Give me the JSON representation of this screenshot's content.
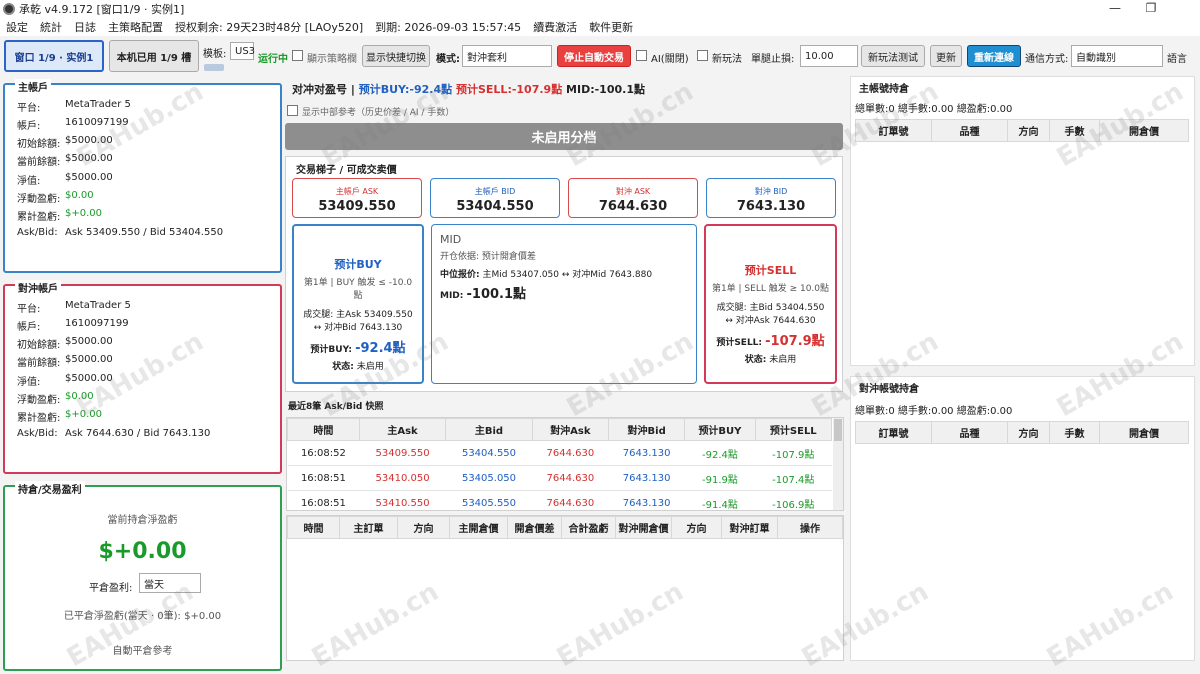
{
  "window": {
    "title": "承乾 v4.9.172 [窗口1/9 · 实例1]",
    "minimize": "—",
    "restore": "❐"
  },
  "menu": [
    "設定",
    "統計",
    "日誌",
    "主策略配置",
    "授权剩余: 29天23时48分 [LAOy520]",
    "到期: 2026-09-03 15:57:45",
    "續費激活",
    "軟件更新"
  ],
  "toolbar": {
    "window_btn": "窗口 1/9 · 实例1",
    "used_btn": "本机已用 1/9 槽",
    "template_label": "模板:",
    "template_value": "US3",
    "running": "运行中",
    "show_strategy": "顯示策略欄",
    "show_quick": "显示快捷切换",
    "mode_label": "模式:",
    "mode_value": "對沖套利",
    "stop_btn": "停止自動交易",
    "ai_label": "AI(關閉)",
    "new_play": "新玩法",
    "single_stop_label": "單腿止損:",
    "single_stop_value": "10.00",
    "new_test": "新玩法测试",
    "refresh": "更新",
    "reconnect": "重新連線",
    "comm_label": "通信方式:",
    "comm_value": "自動識別",
    "lang": "語言"
  },
  "main_account": {
    "title": "主帳戶",
    "rows": [
      {
        "k": "平台:",
        "v": "MetaTrader 5"
      },
      {
        "k": "帳戶:",
        "v": "1610097199"
      },
      {
        "k": "初始餘額:",
        "v": "$5000.00"
      },
      {
        "k": "當前餘額:",
        "v": "$5000.00"
      },
      {
        "k": "淨值:",
        "v": "$5000.00"
      },
      {
        "k": "浮動盈虧:",
        "v": "$0.00"
      },
      {
        "k": "累計盈虧:",
        "v": "$+0.00"
      },
      {
        "k": "Ask/Bid:",
        "v": "Ask 53409.550 / Bid 53404.550"
      }
    ]
  },
  "hedge_account": {
    "title": "對沖帳戶",
    "rows": [
      {
        "k": "平台:",
        "v": "MetaTrader 5"
      },
      {
        "k": "帳戶:",
        "v": "1610097199"
      },
      {
        "k": "初始餘額:",
        "v": "$5000.00"
      },
      {
        "k": "當前餘額:",
        "v": "$5000.00"
      },
      {
        "k": "淨值:",
        "v": "$5000.00"
      },
      {
        "k": "浮動盈虧:",
        "v": "$0.00"
      },
      {
        "k": "累計盈虧:",
        "v": "$+0.00"
      },
      {
        "k": "Ask/Bid:",
        "v": "Ask 7644.630 / Bid 7643.130"
      }
    ]
  },
  "position_pnl": {
    "title": "持倉/交易盈利",
    "current_label": "當前持倉淨盈虧",
    "current_value": "$+0.00",
    "close_label": "平倉盈利:",
    "close_value": "當天",
    "closed_text": "已平倉淨盈虧(當天 · 0筆): $+0.00",
    "auto_close": "自動平倉參考"
  },
  "center": {
    "pair_label": "对冲对盈号 |",
    "est_buy": "预计BUY:-92.4點",
    "est_sell": "预计SELL:-107.9點",
    "mid": "MID:-100.1點",
    "show_mid_ref": "显示中部参考（历史价差 / AI / 手数）",
    "grid_bar": "未启用分档",
    "ladder_title": "交易梯子 / 可成交卖價",
    "quotes": [
      {
        "label": "主帳戶 ASK",
        "value": "53409.550"
      },
      {
        "label": "主帳戶 BID",
        "value": "53404.550"
      },
      {
        "label": "對沖 ASK",
        "value": "7644.630"
      },
      {
        "label": "對沖 BID",
        "value": "7643.130"
      }
    ],
    "buy_box": {
      "title": "预计BUY",
      "line1": "第1单 | BUY 触发 ≤ -10.0",
      "line1b": "點",
      "line2": "成交腿: 主Ask 53409.550",
      "line3": "↔ 对冲Bid 7643.130",
      "est_label": "预计BUY:",
      "est_value": "-92.4點",
      "status_label": "状态:",
      "status_value": "未启用"
    },
    "mid_box": {
      "title": "MID",
      "basis": "开仓依据: 预计開倉價差",
      "ref_label": "中位报价:",
      "ref_value": "主Mid 53407.050 ↔ 对冲Mid 7643.880",
      "mid_label": "MID:",
      "mid_value": "-100.1點"
    },
    "sell_box": {
      "title": "预计SELL",
      "line1": "第1单 | SELL 触发 ≥ 10.0點",
      "line2": "成交腿: 主Bid 53404.550",
      "line3": "↔ 对冲Ask 7644.630",
      "est_label": "预计SELL:",
      "est_value": "-107.9點",
      "status_label": "状态:",
      "status_value": "未启用"
    },
    "recent_title": "最近8筆 Ask/Bid 快照",
    "recent_headers": [
      "時間",
      "主Ask",
      "主Bid",
      "對沖Ask",
      "對沖Bid",
      "预计BUY",
      "预计SELL"
    ],
    "recent_rows": [
      [
        "16:08:52",
        "53409.550",
        "53404.550",
        "7644.630",
        "7643.130",
        "-92.4點",
        "-107.9點"
      ],
      [
        "16:08:51",
        "53410.050",
        "53405.050",
        "7644.630",
        "7643.130",
        "-91.9點",
        "-107.4點"
      ],
      [
        "16:08:51",
        "53410.550",
        "53405.550",
        "7644.630",
        "7643.130",
        "-91.4點",
        "-106.9點"
      ]
    ],
    "order_headers": [
      "時間",
      "主訂單",
      "方向",
      "主開倉價",
      "開倉價差",
      "合計盈虧",
      "對沖開倉價",
      "方向",
      "對沖訂單",
      "操作"
    ]
  },
  "main_positions": {
    "title": "主帳號持倉",
    "summary": "總單數:0  總手數:0.00  總盈虧:0.00",
    "headers": [
      "訂單號",
      "品種",
      "方向",
      "手數",
      "開倉價"
    ]
  },
  "hedge_positions": {
    "title": "對沖帳號持倉",
    "summary": "總單數:0  總手數:0.00  總盈虧:0.00",
    "headers": [
      "訂單號",
      "品種",
      "方向",
      "手數",
      "開倉價"
    ]
  },
  "watermark": "EAHub.cn",
  "colors": {
    "accent_blue": "#2a64c8",
    "danger_red": "#d63030",
    "gain_green": "#1a9a2a"
  }
}
